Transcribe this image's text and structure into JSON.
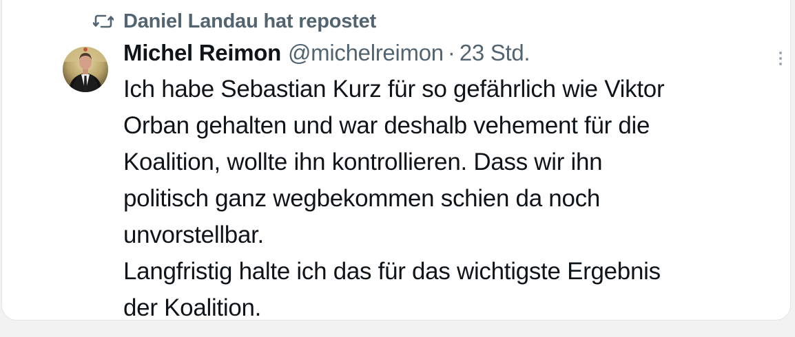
{
  "repost": {
    "icon": "repost-icon",
    "text": "Daniel Landau hat repostet"
  },
  "tweet": {
    "author": {
      "display_name": "Michel Reimon",
      "handle": "@michelreimon",
      "separator": "·",
      "time": "23 Std.",
      "avatar_icon": "avatar-photo"
    },
    "more_icon": "more-options-icon",
    "lines": [
      "Ich habe Sebastian Kurz für so gefährlich wie Viktor",
      "Orban gehalten und war deshalb vehement für die",
      "Koalition, wollte ihn kontrollieren. Dass wir ihn",
      "politisch ganz wegbekommen schien da noch",
      "unvorstellbar.",
      "Langfristig halte ich das für das wichtigste Ergebnis",
      "der Koalition."
    ]
  },
  "colors": {
    "text_primary": "#0f1419",
    "text_secondary": "#536471",
    "background": "#ffffff",
    "page_background": "#f2f2f2"
  }
}
